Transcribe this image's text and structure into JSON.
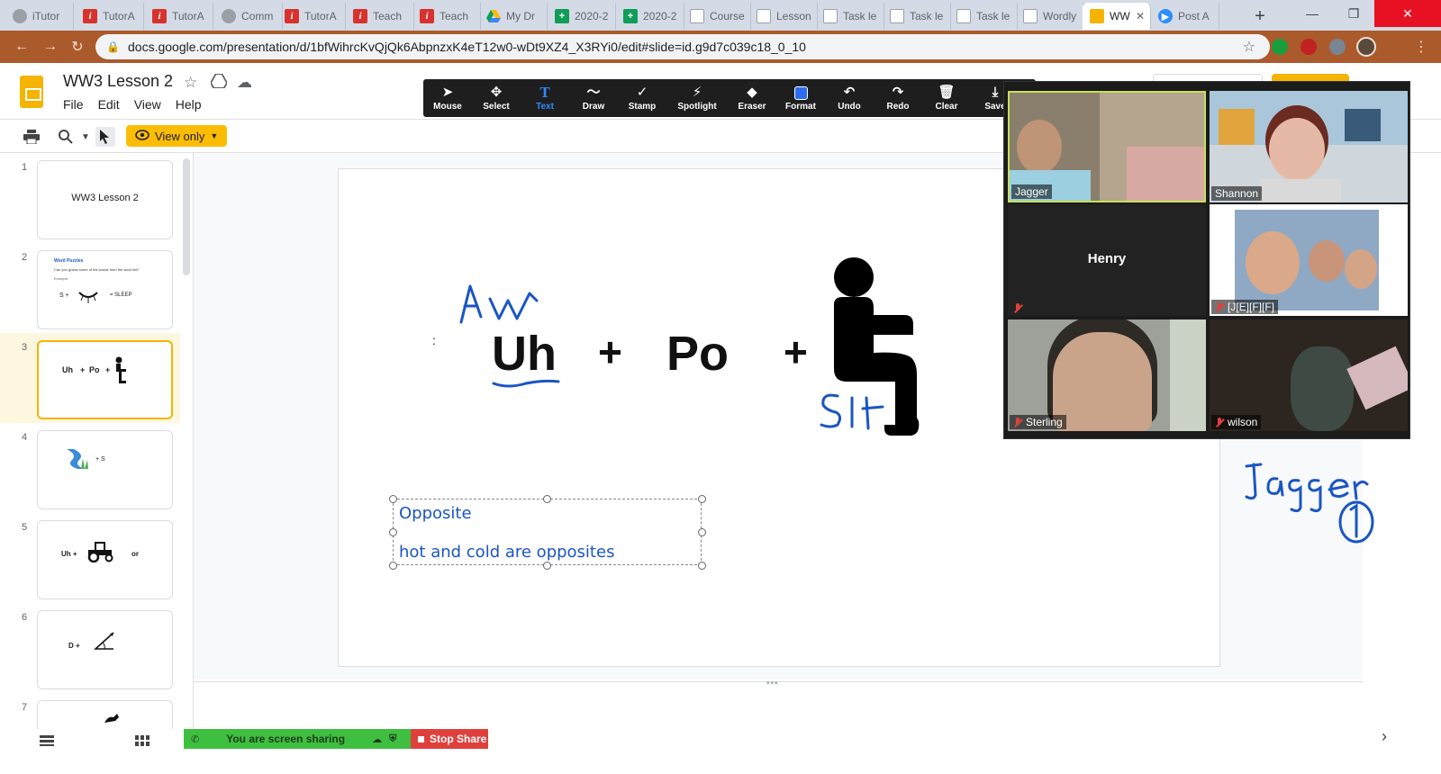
{
  "browser": {
    "tabs": [
      {
        "label": "iTutor",
        "icon": "globe-icon"
      },
      {
        "label": "TutorA",
        "icon": "itutor-icon"
      },
      {
        "label": "TutorA",
        "icon": "itutor-icon"
      },
      {
        "label": "Comm",
        "icon": "globe-icon"
      },
      {
        "label": "TutorA",
        "icon": "itutor-icon"
      },
      {
        "label": "Teach",
        "icon": "itutor-icon"
      },
      {
        "label": "Teach",
        "icon": "itutor-icon"
      },
      {
        "label": "My Dr",
        "icon": "drive-icon"
      },
      {
        "label": "2020-2",
        "icon": "sheets-icon"
      },
      {
        "label": "2020-2",
        "icon": "sheets-icon"
      },
      {
        "label": "Course",
        "icon": "doc-icon"
      },
      {
        "label": "Lesson",
        "icon": "doc-icon"
      },
      {
        "label": "Task le",
        "icon": "doc-icon"
      },
      {
        "label": "Task le",
        "icon": "doc-icon"
      },
      {
        "label": "Task le",
        "icon": "doc-icon"
      },
      {
        "label": "Wordly",
        "icon": "doc-icon"
      },
      {
        "label": "WW",
        "icon": "slides-icon"
      },
      {
        "label": "Post A",
        "icon": "zoom-icon"
      }
    ],
    "url": "docs.google.com/presentation/d/1bfWihrcKvQjQk6AbpnzxK4eT12w0-wDt9XZ4_X3RYi0/edit#slide=id.g9d7c039c18_0_10"
  },
  "app": {
    "title": "WW3 Lesson 2",
    "menu": [
      "File",
      "Edit",
      "View",
      "Help"
    ],
    "view_mode": "View only"
  },
  "filmstrip": [
    {
      "num": "1",
      "content": "WW3 Lesson 2"
    },
    {
      "num": "2",
      "title": "Word Puzzles",
      "subtitle": "Can you guess some of the words from the word list?",
      "hint": "Example",
      "equation_left": "S +",
      "equation_right": "= SLEEP"
    },
    {
      "num": "3",
      "uh": "Uh",
      "plus1": "+",
      "po": "Po",
      "plus2": "+"
    },
    {
      "num": "4",
      "plus": "+ S"
    },
    {
      "num": "5",
      "uh": "Uh +",
      "or": "or"
    },
    {
      "num": "6",
      "d": "D +"
    },
    {
      "num": "7"
    }
  ],
  "slide": {
    "colon": ":",
    "word1": "Uh",
    "plus1": "+",
    "word2": "Po",
    "plus2": "+",
    "textbox_line1": "Opposite",
    "textbox_line2": "hot and cold are opposites"
  },
  "zoom_toolbar": {
    "buttons": [
      {
        "label": "Mouse",
        "icon": "mouse-icon"
      },
      {
        "label": "Select",
        "icon": "select-icon"
      },
      {
        "label": "Text",
        "icon": "text-icon"
      },
      {
        "label": "Draw",
        "icon": "draw-icon"
      },
      {
        "label": "Stamp",
        "icon": "stamp-icon"
      },
      {
        "label": "Spotlight",
        "icon": "spotlight-icon"
      },
      {
        "label": "Eraser",
        "icon": "eraser-icon"
      },
      {
        "label": "Format",
        "icon": "format-icon"
      },
      {
        "label": "Undo",
        "icon": "undo-icon"
      },
      {
        "label": "Redo",
        "icon": "redo-icon"
      },
      {
        "label": "Clear",
        "icon": "clear-icon"
      },
      {
        "label": "Save",
        "icon": "save-icon"
      }
    ],
    "active": "Text",
    "colors": {
      "bar": "#1e1e1e",
      "active": "#2d8cff",
      "close": "#e02828"
    }
  },
  "gallery": {
    "participants": [
      {
        "name": "Jagger",
        "muted": false
      },
      {
        "name": "Shannon",
        "muted": false
      },
      {
        "name": "Henry",
        "muted": true
      },
      {
        "name": "[J[E][F][F]",
        "muted": true
      },
      {
        "name": "Sterling",
        "muted": true
      },
      {
        "name": "wilson",
        "muted": true
      }
    ]
  },
  "share": {
    "status": "You are screen sharing",
    "stop": "Stop Share",
    "colors": {
      "banner": "#3fbf3f",
      "stop": "#e0403c"
    }
  },
  "colors": {
    "accent": "#f4b400",
    "ink": "#1a56c4",
    "chrome": "#ab5a2c"
  }
}
